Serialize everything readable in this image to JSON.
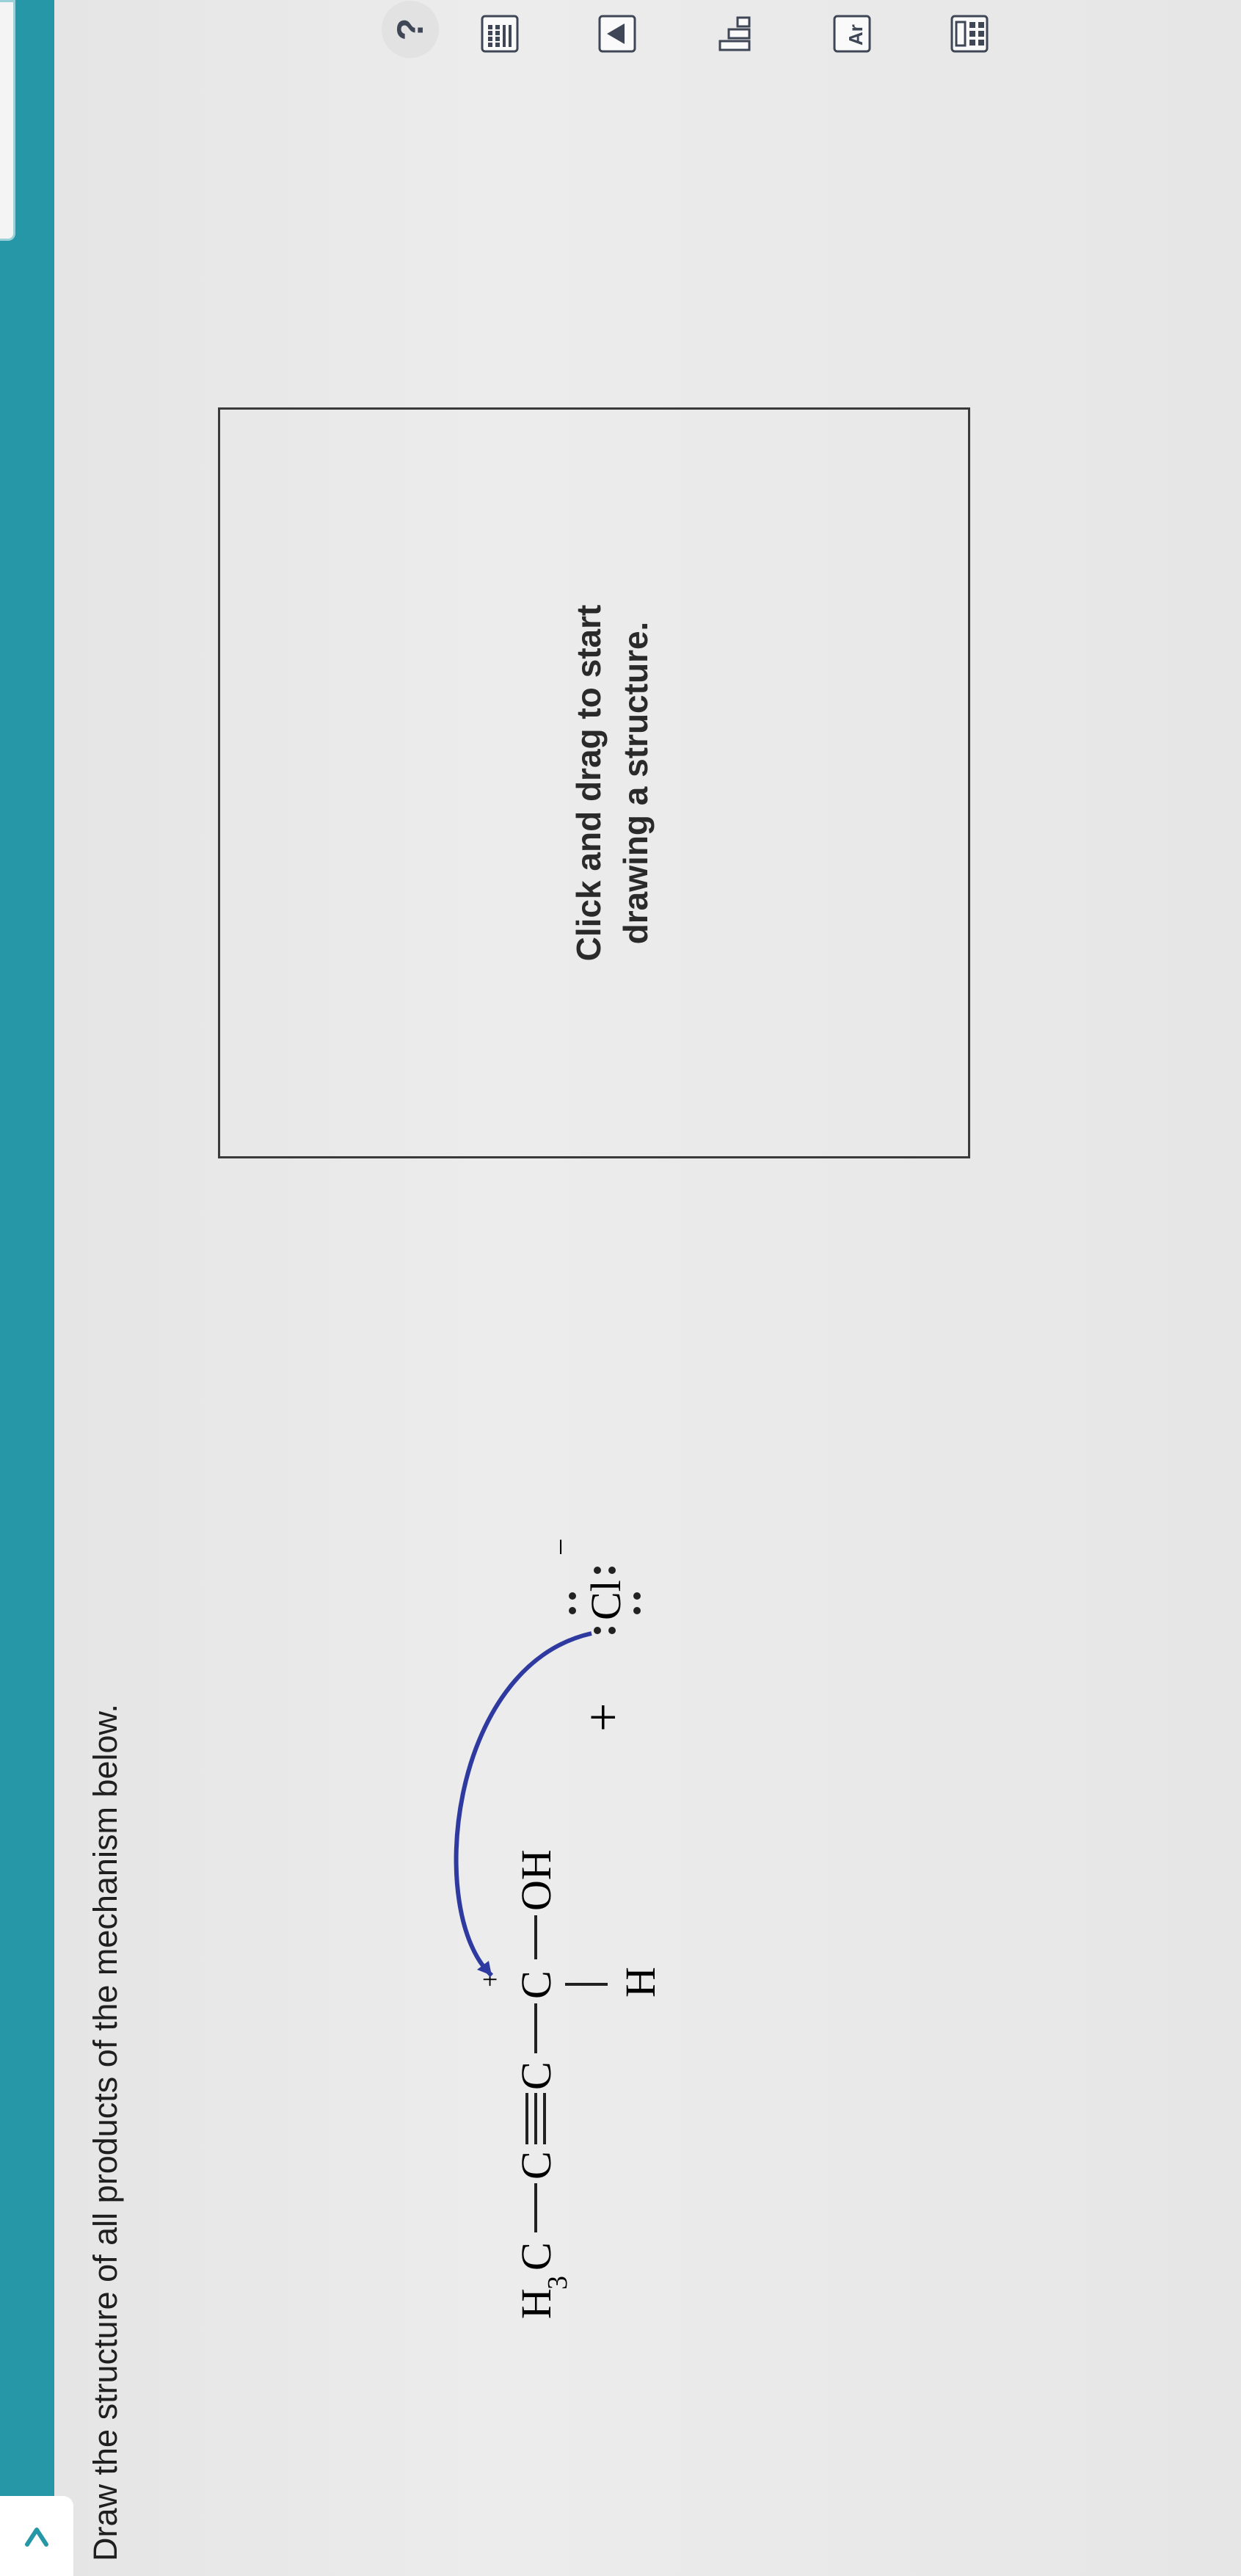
{
  "instruction": "Draw the structure of all products of the mechanism below.",
  "mechanism": {
    "h3c": "H",
    "h3c_sub": "3",
    "c1": "C",
    "c2": "C",
    "c3": "C",
    "c4": "C",
    "oh": "OH",
    "h": "H",
    "carbocation_charge": "+",
    "plus": "+",
    "chloride": "Cl",
    "chloride_charge": "−"
  },
  "drawing_area": {
    "placeholder_line1": "Click and drag to start",
    "placeholder_line2": "drawing a structure."
  },
  "toolbar": {
    "help": "?",
    "template_label": "Ar"
  },
  "colors": {
    "rail": "#2597a6",
    "arrow": "#2f3aa0",
    "text": "#1f1f1f"
  }
}
